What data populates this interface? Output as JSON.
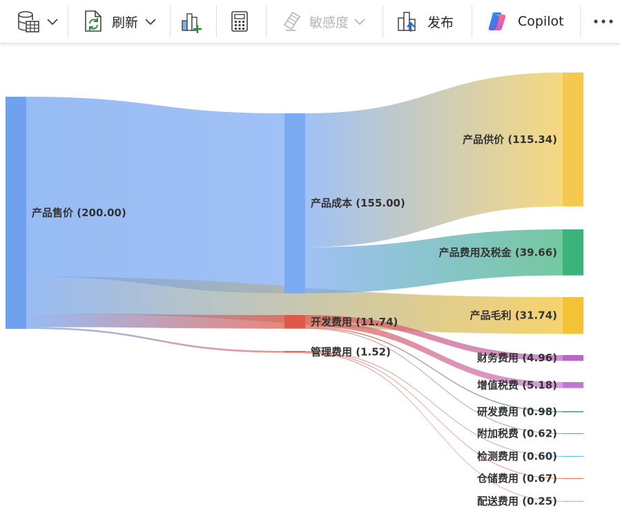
{
  "toolbar": {
    "items": [
      {
        "name": "data-button",
        "icon": "database-table-icon",
        "has_dropdown": true
      },
      {
        "name": "refresh-button",
        "icon": "refresh-icon",
        "label": "刷新",
        "has_dropdown": true
      },
      {
        "name": "new-visual-button",
        "icon": "add-visual-icon"
      },
      {
        "name": "new-measure-button",
        "icon": "calculator-icon"
      },
      {
        "name": "sensitivity-button",
        "icon": "sensitivity-label-icon",
        "label": "敏感度",
        "has_dropdown": true,
        "disabled": true
      },
      {
        "name": "publish-button",
        "icon": "publish-icon",
        "label": "发布"
      },
      {
        "name": "copilot-button",
        "icon": "copilot-icon",
        "label": "Copilot"
      },
      {
        "name": "more-options-button",
        "icon": "more-icon"
      }
    ],
    "refresh_label": "刷新",
    "sensitivity_label": "敏感度",
    "publish_label": "发布",
    "copilot_label": "Copilot"
  },
  "chart_data": {
    "type": "sankey",
    "nodes": [
      {
        "id": "sale",
        "name": "产品售价",
        "value": 200.0,
        "label": "产品售价 (200.00)",
        "color": "#6fa1ef"
      },
      {
        "id": "cost",
        "name": "产品成本",
        "value": 155.0,
        "label": "产品成本 (155.00)",
        "color": "#7ba9f2"
      },
      {
        "id": "dev",
        "name": "开发费用",
        "value": 11.74,
        "label": "开发费用 (11.74)",
        "color": "#e05848"
      },
      {
        "id": "mgmt",
        "name": "管理费用",
        "value": 1.52,
        "label": "管理费用 (1.52)",
        "color": "#e06a5c"
      },
      {
        "id": "supply",
        "name": "产品供价",
        "value": 115.34,
        "label": "产品供价 (115.34)",
        "color": "#f4c94e"
      },
      {
        "id": "fee_tax",
        "name": "产品费用及税金",
        "value": 39.66,
        "label": "产品费用及税金 (39.66)",
        "color": "#3db37c"
      },
      {
        "id": "margin",
        "name": "产品毛利",
        "value": 31.74,
        "label": "产品毛利 (31.74)",
        "color": "#f4c236"
      },
      {
        "id": "finance",
        "name": "财务费用",
        "value": 4.96,
        "label": "财务费用 (4.96)",
        "color": "#b867c6"
      },
      {
        "id": "vat",
        "name": "增值税费",
        "value": 5.18,
        "label": "增值税费 (5.18)",
        "color": "#c277d0"
      },
      {
        "id": "rnd",
        "name": "研发费用",
        "value": 0.98,
        "label": "研发费用 (0.98)",
        "color": "#3aa889"
      },
      {
        "id": "surtax",
        "name": "附加税费",
        "value": 0.62,
        "label": "附加税费 (0.62)",
        "color": "#4bb4cf"
      },
      {
        "id": "inspect",
        "name": "检测费用",
        "value": 0.6,
        "label": "检测费用 (0.60)",
        "color": "#62bde3"
      },
      {
        "id": "storage",
        "name": "仓储费用",
        "value": 0.67,
        "label": "仓储费用 (0.67)",
        "color": "#e57f68"
      },
      {
        "id": "delivery",
        "name": "配送费用",
        "value": 0.25,
        "label": "配送费用 (0.25)",
        "color": "#eea08f"
      }
    ],
    "links": [
      {
        "source": "sale",
        "target": "cost",
        "value": 155.0
      },
      {
        "source": "sale",
        "target": "margin",
        "value": 31.74
      },
      {
        "source": "sale",
        "target": "dev",
        "value": 11.74
      },
      {
        "source": "sale",
        "target": "mgmt",
        "value": 1.52
      },
      {
        "source": "cost",
        "target": "supply",
        "value": 115.34
      },
      {
        "source": "cost",
        "target": "fee_tax",
        "value": 39.66
      },
      {
        "source": "dev",
        "target": "finance",
        "value": 4.96
      },
      {
        "source": "dev",
        "target": "vat",
        "value": 5.18
      },
      {
        "source": "dev",
        "target": "rnd",
        "value": 0.98
      },
      {
        "source": "dev",
        "target": "surtax",
        "value": 0.62
      },
      {
        "source": "mgmt",
        "target": "inspect",
        "value": 0.6
      },
      {
        "source": "mgmt",
        "target": "storage",
        "value": 0.67
      },
      {
        "source": "mgmt",
        "target": "delivery",
        "value": 0.25
      }
    ]
  }
}
